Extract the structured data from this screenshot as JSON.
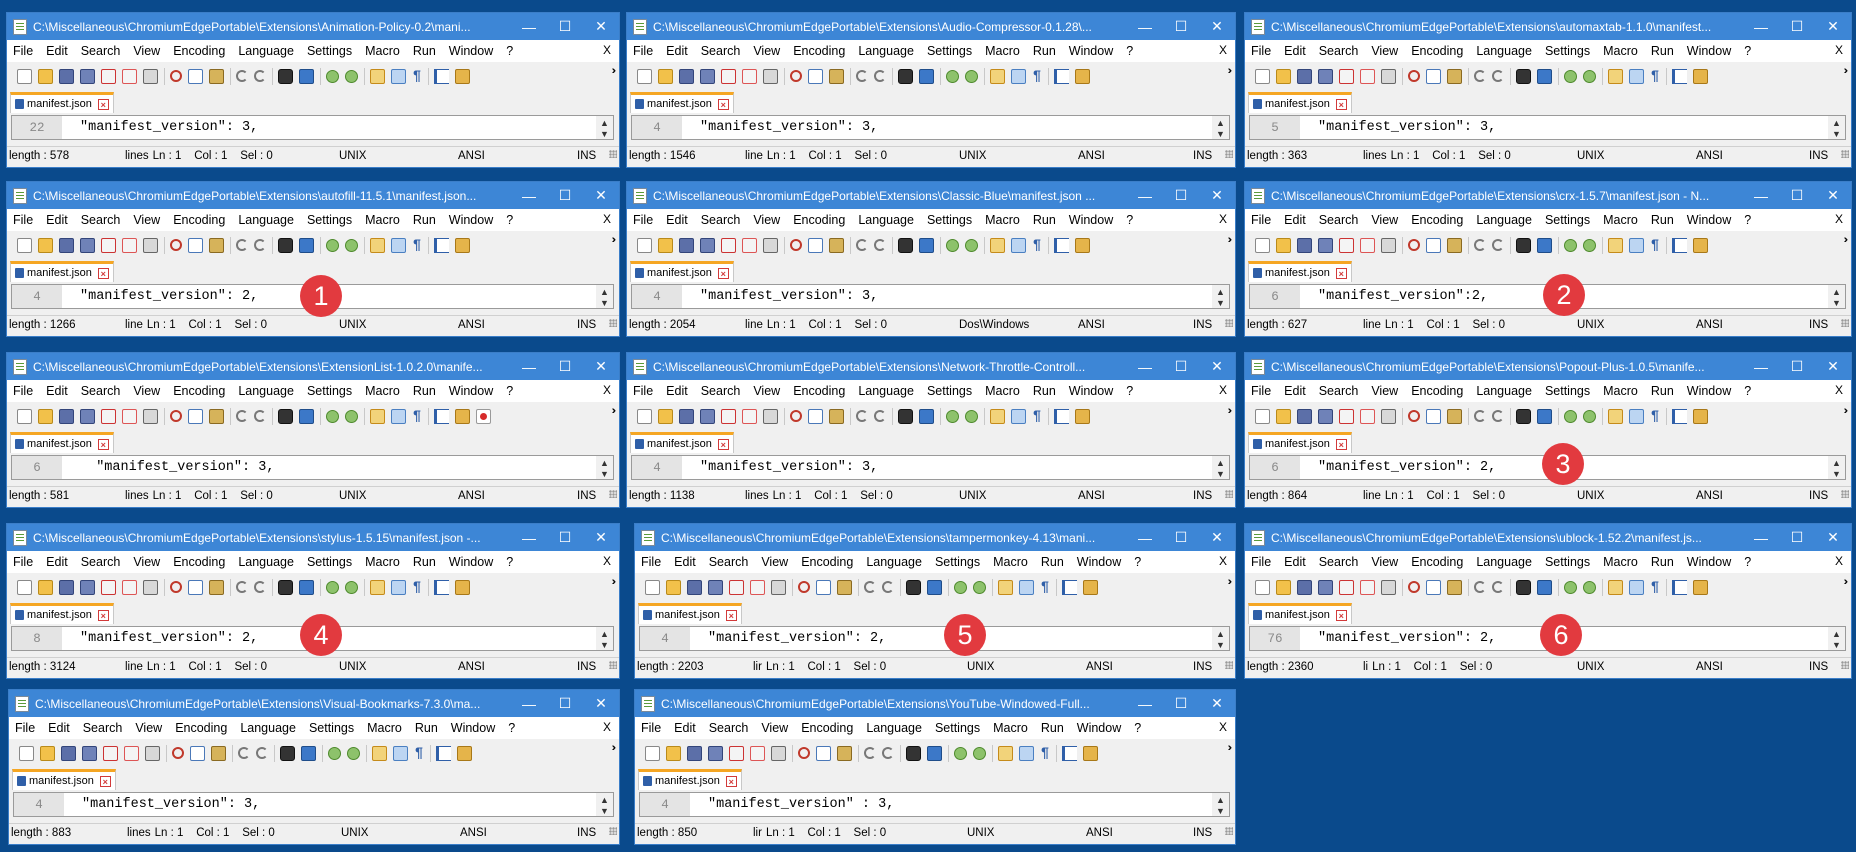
{
  "menu": [
    "File",
    "Edit",
    "Search",
    "View",
    "Encoding",
    "Language",
    "Settings",
    "Macro",
    "Run",
    "Window",
    "?"
  ],
  "menu_close": "X",
  "window_controls": {
    "minimize": "—",
    "maximize": "☐",
    "close": "✕"
  },
  "toolbar_icons": [
    "new-file-icon",
    "open-file-icon",
    "save-icon",
    "save-all-icon",
    "close-icon",
    "close-all-icon",
    "print-icon",
    "cut-icon",
    "copy-icon",
    "paste-icon",
    "undo-icon",
    "redo-icon",
    "find-icon",
    "replace-icon",
    "zoom-in-icon",
    "zoom-out-icon",
    "sync-scroll-icon",
    "word-wrap-icon",
    "show-all-chars-icon",
    "indent-guide-icon",
    "macro-icon"
  ],
  "tab_label": "manifest.json",
  "status_ins": "INS",
  "windows": [
    {
      "title": "C:\\Miscellaneous\\ChromiumEdgePortable\\Extensions\\Animation-Policy-0.2\\mani...",
      "line_num": "22",
      "code": "\"manifest_version\": 3,",
      "length": "length : 578",
      "lines": "lines",
      "pos": "Ln : 1    Col : 1    Sel : 0",
      "eol": "UNIX",
      "enc": "ANSI"
    },
    {
      "title": "C:\\Miscellaneous\\ChromiumEdgePortable\\Extensions\\Audio-Compressor-0.1.28\\...",
      "line_num": "4",
      "code": "\"manifest_version\": 3,",
      "length": "length : 1546",
      "lines": "line",
      "pos": "Ln : 1    Col : 1    Sel : 0",
      "eol": "UNIX",
      "enc": "ANSI"
    },
    {
      "title": "C:\\Miscellaneous\\ChromiumEdgePortable\\Extensions\\automaxtab-1.1.0\\manifest...",
      "line_num": "5",
      "code": "\"manifest_version\": 3,",
      "length": "length : 363",
      "lines": "lines",
      "pos": "Ln : 1    Col : 1    Sel : 0",
      "eol": "UNIX",
      "enc": "ANSI"
    },
    {
      "title": "C:\\Miscellaneous\\ChromiumEdgePortable\\Extensions\\autofill-11.5.1\\manifest.json...",
      "line_num": "4",
      "code": "\"manifest_version\": 2,",
      "length": "length : 1266",
      "lines": "line",
      "pos": "Ln : 1    Col : 1    Sel : 0",
      "eol": "UNIX",
      "enc": "ANSI"
    },
    {
      "title": "C:\\Miscellaneous\\ChromiumEdgePortable\\Extensions\\Classic-Blue\\manifest.json ...",
      "line_num": "4",
      "code": "\"manifest_version\": 3,",
      "length": "length : 2054",
      "lines": "line",
      "pos": "Ln : 1    Col : 1    Sel : 0",
      "eol": "Dos\\Windows",
      "enc": "ANSI"
    },
    {
      "title": "C:\\Miscellaneous\\ChromiumEdgePortable\\Extensions\\crx-1.5.7\\manifest.json - N...",
      "line_num": "6",
      "code": "\"manifest_version\":2,",
      "length": "length : 627",
      "lines": "line",
      "pos": "Ln : 1    Col : 1    Sel : 0",
      "eol": "UNIX",
      "enc": "ANSI"
    },
    {
      "title": "C:\\Miscellaneous\\ChromiumEdgePortable\\Extensions\\ExtensionList-1.0.2.0\\manife...",
      "line_num": "6",
      "code": "  \"manifest_version\": 3,",
      "length": "length : 581",
      "lines": "lines",
      "pos": "Ln : 1    Col : 1    Sel : 0",
      "eol": "UNIX",
      "enc": "ANSI"
    },
    {
      "title": "C:\\Miscellaneous\\ChromiumEdgePortable\\Extensions\\Network-Throttle-Controll...",
      "line_num": "4",
      "code": "\"manifest_version\": 3,",
      "length": "length : 1138",
      "lines": "lines",
      "pos": "Ln : 1    Col : 1    Sel : 0",
      "eol": "UNIX",
      "enc": "ANSI"
    },
    {
      "title": "C:\\Miscellaneous\\ChromiumEdgePortable\\Extensions\\Popout-Plus-1.0.5\\manife...",
      "line_num": "6",
      "code": "\"manifest_version\": 2,",
      "length": "length : 864",
      "lines": "line",
      "pos": "Ln : 1    Col : 1    Sel : 0",
      "eol": "UNIX",
      "enc": "ANSI"
    },
    {
      "title": "C:\\Miscellaneous\\ChromiumEdgePortable\\Extensions\\stylus-1.5.15\\manifest.json -...",
      "line_num": "8",
      "code": "\"manifest_version\": 2,",
      "length": "length : 3124",
      "lines": "line",
      "pos": "Ln : 1    Col : 1    Sel : 0",
      "eol": "UNIX",
      "enc": "ANSI"
    },
    {
      "title": "C:\\Miscellaneous\\ChromiumEdgePortable\\Extensions\\tampermonkey-4.13\\mani...",
      "line_num": "4",
      "code": "\"manifest_version\": 2,",
      "length": "length : 2203",
      "lines": "lir",
      "pos": "Ln : 1    Col : 1    Sel : 0",
      "eol": "UNIX",
      "enc": "ANSI"
    },
    {
      "title": "C:\\Miscellaneous\\ChromiumEdgePortable\\Extensions\\ublock-1.52.2\\manifest.js...",
      "line_num": "76",
      "code": "\"manifest_version\": 2,",
      "length": "length : 2360",
      "lines": "li",
      "pos": "Ln : 1    Col : 1    Sel : 0",
      "eol": "UNIX",
      "enc": "ANSI"
    },
    {
      "title": "C:\\Miscellaneous\\ChromiumEdgePortable\\Extensions\\Visual-Bookmarks-7.3.0\\ma...",
      "line_num": "4",
      "code": "\"manifest_version\": 3,",
      "length": "length : 883",
      "lines": "lines",
      "pos": "Ln : 1    Col : 1    Sel : 0",
      "eol": "UNIX",
      "enc": "ANSI"
    },
    {
      "title": "C:\\Miscellaneous\\ChromiumEdgePortable\\Extensions\\YouTube-Windowed-Full...",
      "line_num": "4",
      "code": "\"manifest_version\" : 3,",
      "length": "length : 850",
      "lines": "lir",
      "pos": "Ln : 1    Col : 1    Sel : 0",
      "eol": "UNIX",
      "enc": "ANSI"
    }
  ],
  "callouts": [
    "1",
    "2",
    "3",
    "4",
    "5",
    "6"
  ]
}
